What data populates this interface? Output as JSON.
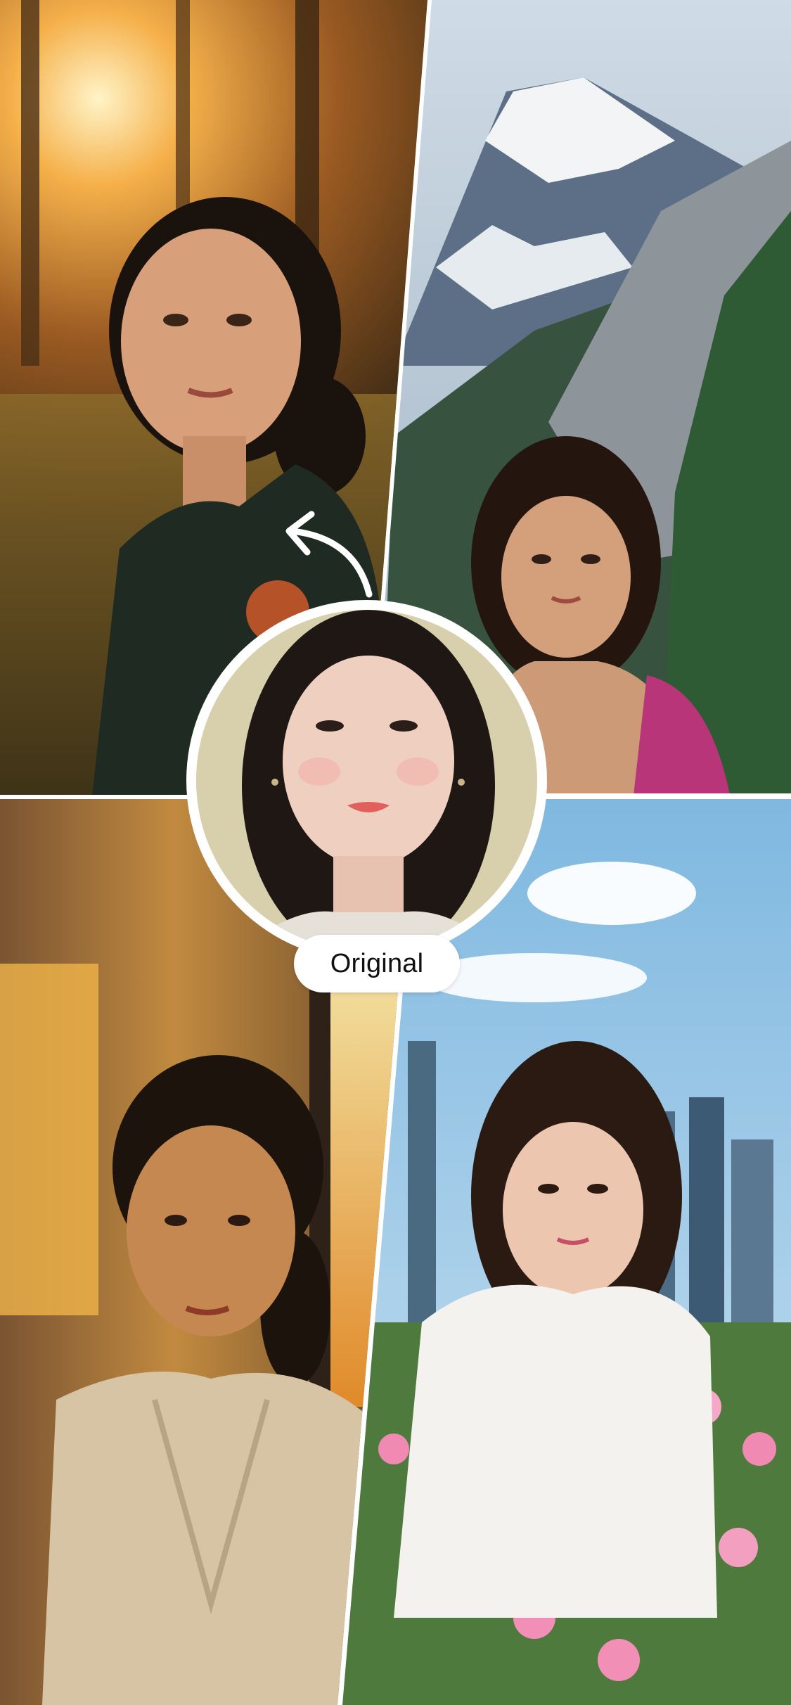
{
  "overlay": {
    "original_label": "Original"
  },
  "icons": {
    "arrow": "curved-arrow-icon"
  },
  "colors": {
    "divider": "#ffffff",
    "pill_background": "#ffffff",
    "pill_text": "#111111"
  }
}
